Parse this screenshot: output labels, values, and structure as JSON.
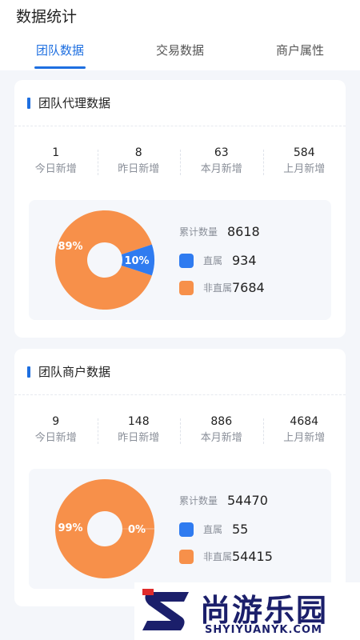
{
  "page": {
    "title": "数据统计"
  },
  "tabs": [
    {
      "label": "团队数据",
      "active": true
    },
    {
      "label": "交易数据",
      "active": false
    },
    {
      "label": "商户属性",
      "active": false
    }
  ],
  "agent_card": {
    "title": "团队代理数据",
    "stats": [
      {
        "value": "1",
        "label": "今日新增"
      },
      {
        "value": "8",
        "label": "昨日新增"
      },
      {
        "value": "63",
        "label": "本月新增"
      },
      {
        "value": "584",
        "label": "上月新增"
      }
    ],
    "summary": {
      "total_label": "累计数量",
      "total_value": "8618",
      "direct_label": "直属",
      "direct_value": "934",
      "indirect_label": "非直属",
      "indirect_value": "7684"
    },
    "donut": {
      "direct_pct": 10,
      "indirect_pct": 89,
      "direct_text": "10%",
      "indirect_text": "89%"
    }
  },
  "merchant_card": {
    "title": "团队商户数据",
    "stats": [
      {
        "value": "9",
        "label": "今日新增"
      },
      {
        "value": "148",
        "label": "昨日新增"
      },
      {
        "value": "886",
        "label": "本月新增"
      },
      {
        "value": "4684",
        "label": "上月新增"
      }
    ],
    "summary": {
      "total_label": "累计数量",
      "total_value": "54470",
      "direct_label": "直属",
      "direct_value": "55",
      "indirect_label": "非直属",
      "indirect_value": "54415"
    },
    "donut": {
      "direct_pct": 0.1,
      "indirect_pct": 99.9,
      "direct_text": "0%",
      "indirect_text": "99%"
    }
  },
  "colors": {
    "accent": "#1e6fe0",
    "direct": "#2f7bf0",
    "indirect": "#f7904a"
  },
  "watermark": {
    "text": "尚游乐园",
    "url": "SHYIYUANYK.COM"
  }
}
